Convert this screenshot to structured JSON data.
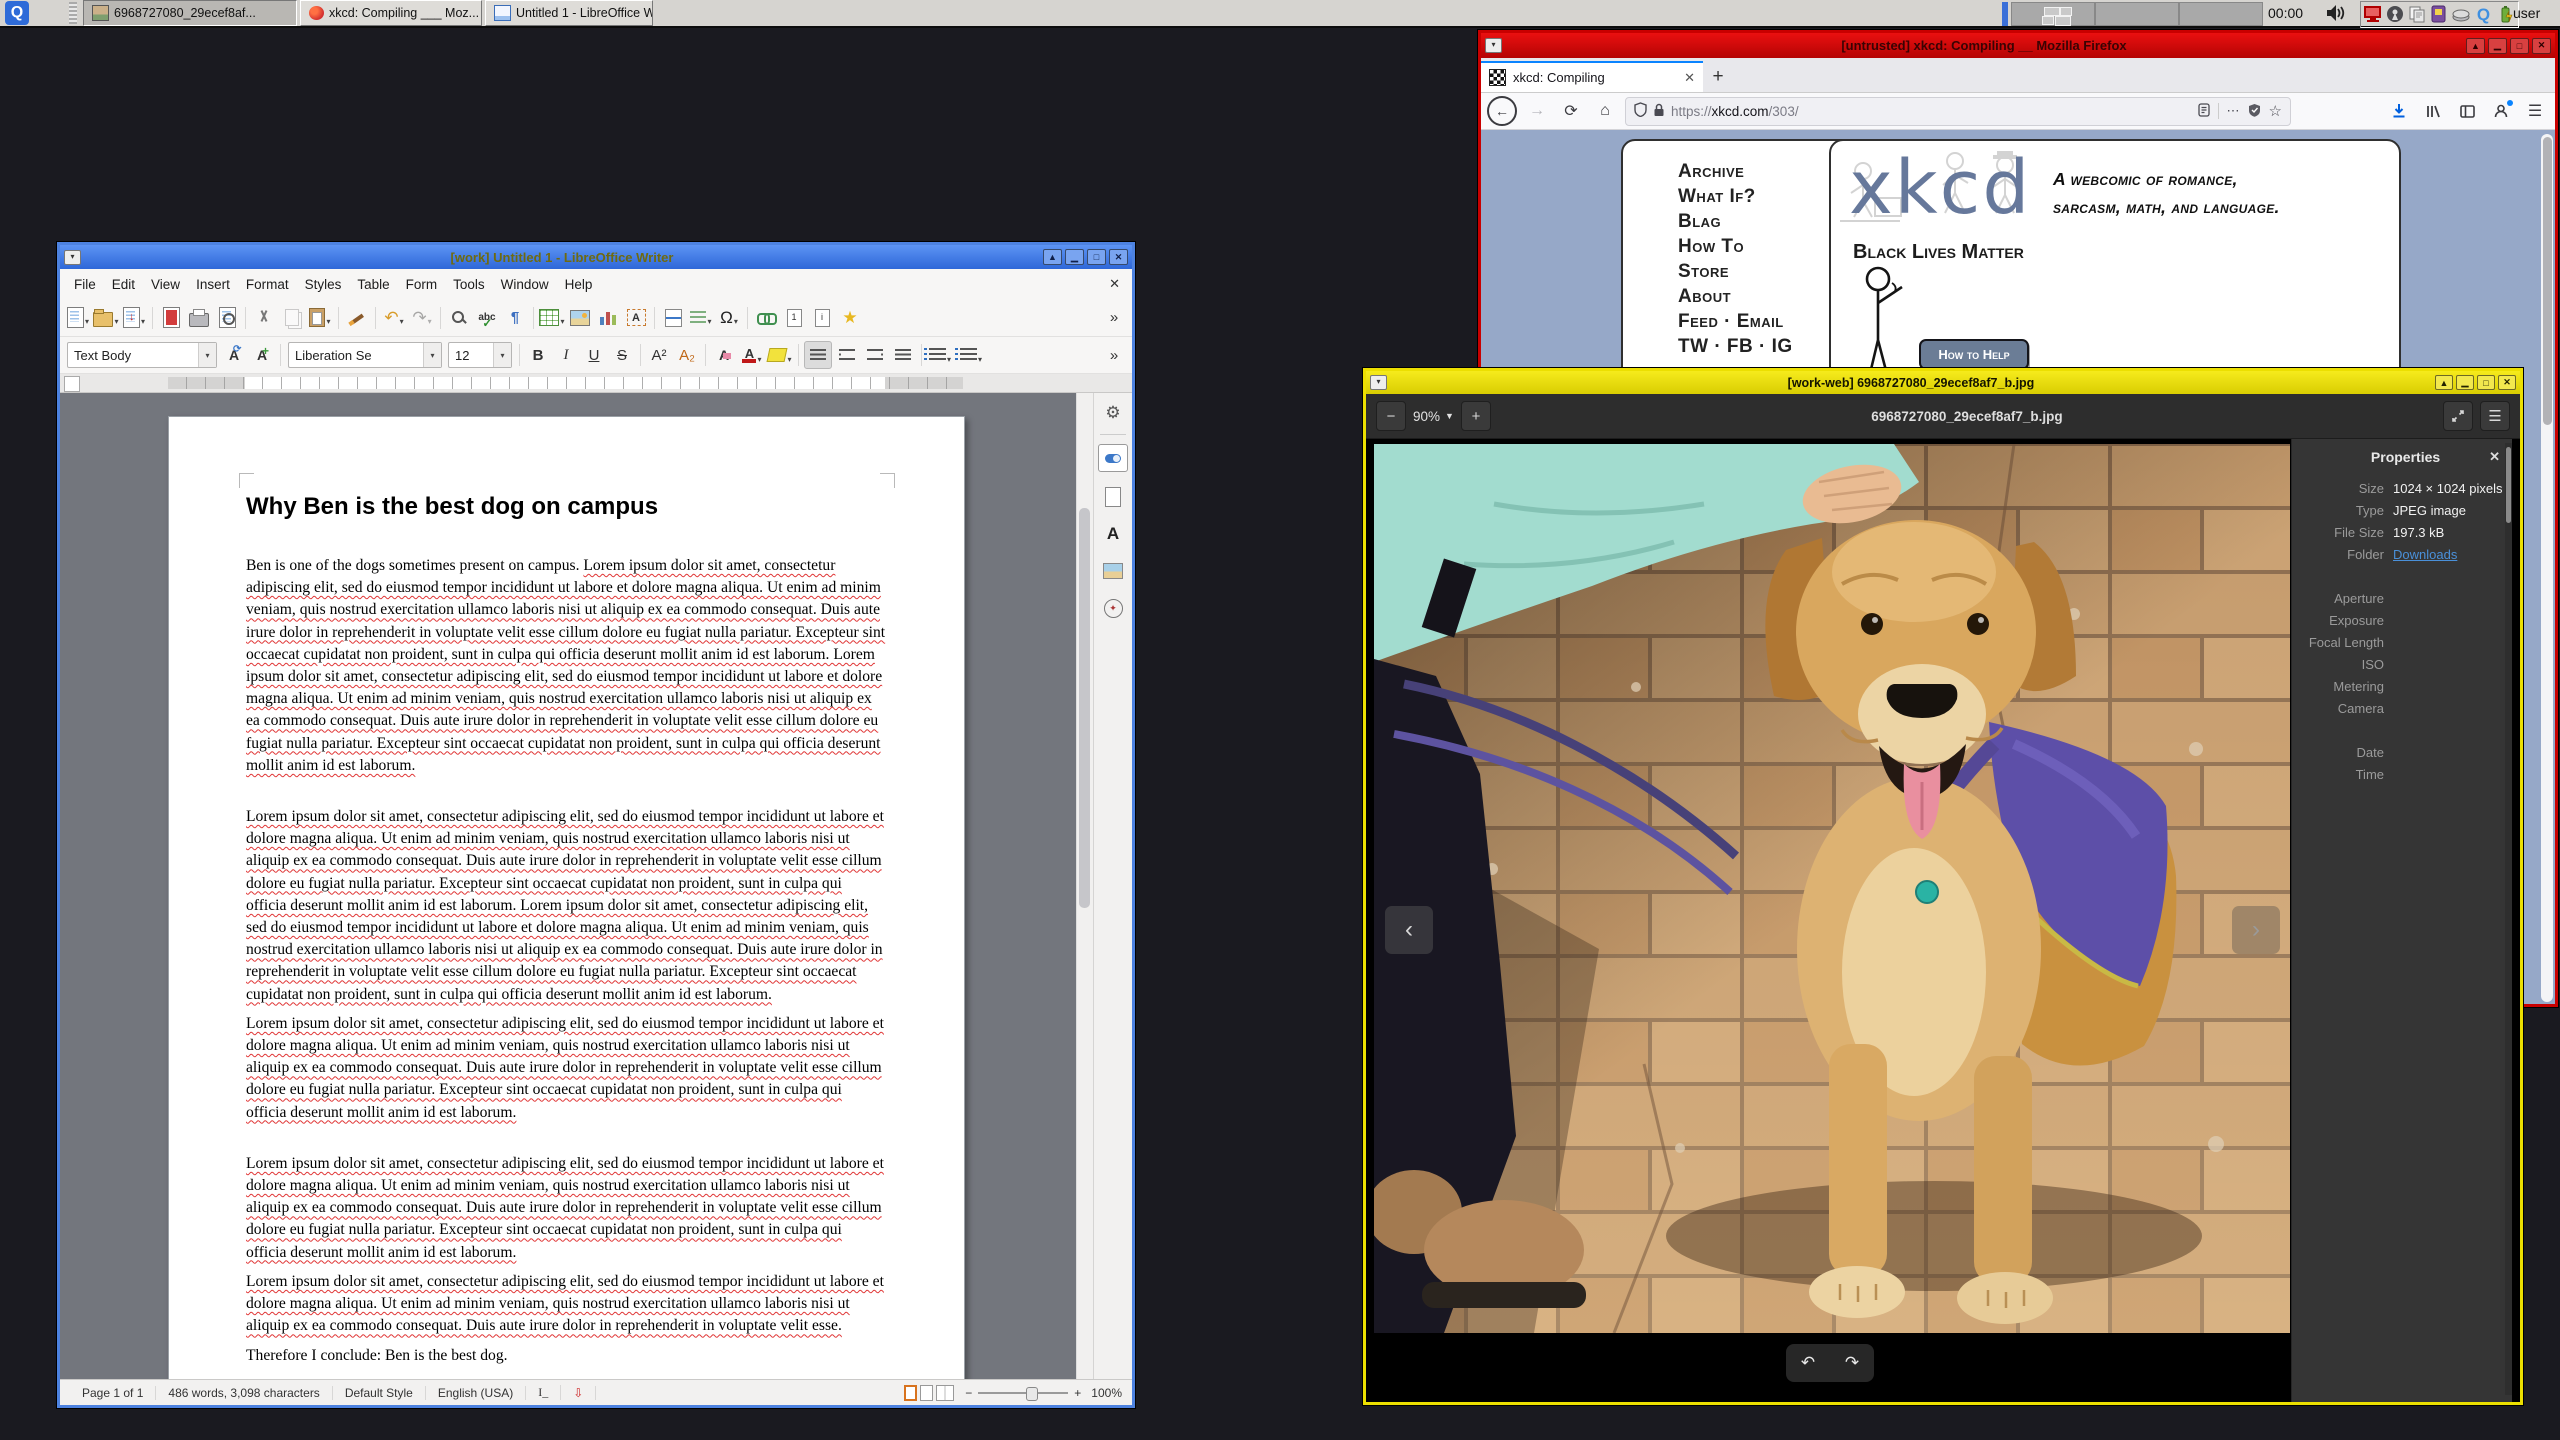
{
  "taskbar": {
    "launcher_label": "Q",
    "buttons": [
      {
        "label": "6968727080_29ecef8af...",
        "icon": "image-thumbnail",
        "active": true
      },
      {
        "label": "xkcd: Compiling ___ Moz...",
        "icon": "firefox",
        "active": false
      },
      {
        "label": "Untitled 1 - LibreOffice W...",
        "icon": "writer-document",
        "active": false
      }
    ],
    "pager_cells": 3,
    "clock": "00:00",
    "user_label": "user",
    "tray_icon_names": [
      "speaker",
      "display",
      "privacy-keyhole",
      "clipboard",
      "removable-media",
      "disk",
      "qubes",
      "battery"
    ]
  },
  "firefox": {
    "window_title": "[untrusted] xkcd: Compiling __ Mozilla Firefox",
    "tab_title": "xkcd: Compiling",
    "new_tab_label": "+",
    "url": {
      "protocol": "https://",
      "host": "xkcd.com",
      "path": "/303/"
    },
    "navbar_icon_names": [
      "back",
      "forward",
      "reload",
      "home",
      "tracking-shield",
      "lock",
      "reader-mode",
      "page-actions",
      "shield-check",
      "bookmark-star",
      "download",
      "library",
      "sidebar",
      "account",
      "app-menu"
    ],
    "xkcd": {
      "menu_items": [
        "Archive",
        "What If?",
        "Blag",
        "How To",
        "Store",
        "About",
        "Feed · Email",
        "TW · FB · IG"
      ],
      "logo_text": "xkcd",
      "tagline_line1": "A webcomic of romance,",
      "tagline_line2": "sarcasm, math, and language.",
      "blm_text": "Black Lives Matter",
      "help_button_label": "How to Help"
    }
  },
  "writer": {
    "window_title": "[work] Untitled 1 - LibreOffice Writer",
    "menu_items": [
      "File",
      "Edit",
      "View",
      "Insert",
      "Format",
      "Styles",
      "Table",
      "Form",
      "Tools",
      "Window",
      "Help"
    ],
    "std_toolbar_icon_names": [
      "new-document",
      "open",
      "save",
      "export-pdf",
      "print",
      "print-preview",
      "cut",
      "copy",
      "paste",
      "clone-formatting",
      "undo",
      "redo",
      "find-replace",
      "spelling",
      "formatting-marks",
      "insert-table",
      "insert-image",
      "insert-chart",
      "insert-text-box",
      "page-break",
      "insert-field",
      "special-character",
      "hyperlink",
      "footnote",
      "endnote",
      "bookmark",
      "more-options"
    ],
    "sidebar_icon_names": [
      "sidebar-settings",
      "properties-deck",
      "page-deck",
      "styles-deck",
      "gallery-deck",
      "navigator-deck"
    ],
    "fmt": {
      "paragraph_style": "Text Body",
      "font_name": "Liberation Se",
      "font_size": "12",
      "glyphs": {
        "bold": "B",
        "italic": "I",
        "underline": "U",
        "strikethrough": "S",
        "superscript": "A²",
        "subscript": "A₂",
        "clear_formatting": "A",
        "font_color": "A",
        "undo": "↶",
        "redo": "↷",
        "pilcrow": "¶",
        "omega": "Ω",
        "star": "★",
        "more": "»"
      }
    },
    "document": {
      "heading": "Why Ben is the best dog on campus",
      "paragraphs": [
        {
          "segments": [
            {
              "text": "Ben is one of the dogs sometimes present on campus. ",
              "misspelled": false
            },
            {
              "text": "Lorem ipsum dolor sit amet, consectetur adipiscing elit, sed do eiusmod tempor incididunt ut labore et dolore magna aliqua. Ut enim ad minim veniam, quis nostrud exercitation ullamco laboris nisi ut aliquip ex ea commodo consequat. Duis aute irure dolor in reprehenderit in voluptate velit esse cillum dolore eu fugiat nulla pariatur. Excepteur sint occaecat cupidatat non proident, sunt in culpa qui officia deserunt mollit anim id est laborum. Lorem ipsum dolor sit amet, consectetur adipiscing elit, sed do eiusmod tempor incididunt ut labore et dolore magna aliqua. Ut enim ad minim veniam, quis nostrud exercitation ullamco laboris nisi ut aliquip ex ea commodo consequat. Duis aute irure dolor in reprehenderit in voluptate velit esse cillum dolore eu fugiat nulla pariatur. Excepteur sint occaecat cupidatat non proident, sunt in culpa qui officia deserunt mollit anim id est laborum.",
              "misspelled": true
            }
          ]
        },
        {
          "segments": [
            {
              "text": "Lorem ipsum dolor sit amet, consectetur adipiscing elit, sed do eiusmod tempor incididunt ut labore et dolore magna aliqua. Ut enim ad minim veniam, quis nostrud exercitation ullamco laboris nisi ut aliquip ex ea commodo consequat. Duis aute irure dolor in reprehenderit in voluptate velit esse cillum dolore eu fugiat nulla pariatur. Excepteur sint occaecat cupidatat non proident, sunt in culpa qui officia deserunt mollit anim id est laborum. Lorem ipsum dolor sit amet, consectetur adipiscing elit, sed do eiusmod tempor incididunt ut labore et dolore magna aliqua. Ut enim ad minim veniam, quis nostrud exercitation ullamco laboris nisi ut aliquip ex ea commodo consequat. Duis aute irure dolor in reprehenderit in voluptate velit esse cillum dolore eu fugiat nulla pariatur. Excepteur sint occaecat cupidatat non proident, sunt in culpa qui officia deserunt mollit anim id est laborum.",
              "misspelled": true
            }
          ]
        },
        {
          "segments": [
            {
              "text": "Lorem ipsum dolor sit amet, consectetur adipiscing elit, sed do eiusmod tempor incididunt ut labore et dolore magna aliqua. Ut enim ad minim veniam, quis nostrud exercitation ullamco laboris nisi ut aliquip ex ea commodo consequat. Duis aute irure dolor in reprehenderit in voluptate velit esse cillum dolore eu fugiat nulla pariatur. Excepteur sint occaecat cupidatat non proident, sunt in culpa qui officia deserunt mollit anim id est laborum.",
              "misspelled": true
            }
          ]
        },
        {
          "segments": [
            {
              "text": "Lorem ipsum dolor sit amet, consectetur adipiscing elit, sed do eiusmod tempor incididunt ut labore et dolore magna aliqua. Ut enim ad minim veniam, quis nostrud exercitation ullamco laboris nisi ut aliquip ex ea commodo consequat. Duis aute irure dolor in reprehenderit in voluptate velit esse cillum dolore eu fugiat nulla pariatur. Excepteur sint occaecat cupidatat non proident, sunt in culpa qui officia deserunt mollit anim id est laborum.",
              "misspelled": true
            }
          ]
        },
        {
          "segments": [
            {
              "text": "Lorem ipsum dolor sit amet, consectetur adipiscing elit, sed do eiusmod tempor incididunt ut labore et dolore magna aliqua. Ut enim ad minim veniam, quis nostrud exercitation ullamco laboris nisi ut aliquip ex ea commodo consequat. Duis aute irure dolor in reprehenderit in voluptate velit esse.",
              "misspelled": true
            }
          ]
        },
        {
          "segments": [
            {
              "text": "Therefore I conclude: Ben is the best dog.",
              "misspelled": false
            }
          ]
        }
      ]
    },
    "statusbar": {
      "page": "Page 1 of 1",
      "word_count": "486 words, 3,098 characters",
      "style": "Default Style",
      "language": "English (USA)",
      "zoom": "100%"
    }
  },
  "viewer": {
    "window_title": "[work-web] 6968727080_29ecef8af7_b.jpg",
    "zoom_level": "90%",
    "header_title": "6968727080_29ecef8af7_b.jpg",
    "header_icon_names": [
      "zoom-out",
      "zoom-dropdown",
      "zoom-in",
      "fullscreen",
      "app-menu"
    ],
    "overlay_icon_names": [
      "previous-image",
      "next-image",
      "rotate-left",
      "rotate-right"
    ],
    "properties": {
      "title": "Properties",
      "rows": [
        {
          "label": "Size",
          "value": "1024 × 1024 pixels"
        },
        {
          "label": "Type",
          "value": "JPEG image"
        },
        {
          "label": "File Size",
          "value": "197.3 kB"
        },
        {
          "label": "Folder",
          "value": "Downloads"
        }
      ],
      "exif_labels": [
        "Aperture",
        "Exposure",
        "Focal Length",
        "ISO",
        "Metering",
        "Camera"
      ],
      "datetime_labels": [
        "Date",
        "Time"
      ]
    }
  }
}
